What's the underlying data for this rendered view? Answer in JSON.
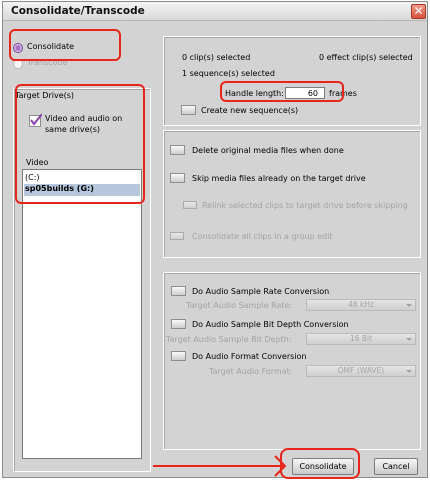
{
  "window": {
    "title": "Consolidate/Transcode",
    "close_glyph": "✕"
  },
  "mode": {
    "consolidate": "Consolidate",
    "transcode": "Transcode"
  },
  "target_drives": {
    "title": "Target Drive(s)",
    "video_audio_same_line1": "Video and audio on",
    "video_audio_same_line2": "same drive(s)",
    "video_label": "Video",
    "drives": [
      "(C:)",
      "sp05builds (G:)"
    ],
    "selected_drive": "sp05builds (G:)"
  },
  "selection": {
    "clips_selected": "0 clip(s) selected",
    "effect_clips_selected": "0 effect clip(s) selected",
    "sequences_selected": "1 sequence(s) selected",
    "handle_length_label": "Handle length:",
    "handle_length_value": "60",
    "handle_length_unit": "frames",
    "create_new_sequences": "Create new sequence(s)"
  },
  "options": {
    "delete_original": "Delete original media files when done",
    "skip_media": "Skip media files already on the target drive",
    "relink": "Relink selected clips to target drive before skipping",
    "consolidate_group": "Consolidate all clips in a group edit"
  },
  "audio": {
    "sample_rate_conversion": "Do Audio Sample Rate Conversion",
    "sample_rate_label": "Target Audio Sample Rate:",
    "sample_rate_value": "48 kHz",
    "bit_depth_conversion": "Do Audio Sample Bit Depth Conversion",
    "bit_depth_label": "Target Audio Sample Bit Depth:",
    "bit_depth_value": "16 Bit",
    "format_conversion": "Do Audio Format Conversion",
    "format_label": "Target Audio Format:",
    "format_value": "OMF (WAVE)"
  },
  "buttons": {
    "consolidate": "Consolidate",
    "cancel": "Cancel"
  },
  "colors": {
    "highlight": "#e8251b",
    "accent": "#a86fc4",
    "selection": "#b6c7de"
  }
}
